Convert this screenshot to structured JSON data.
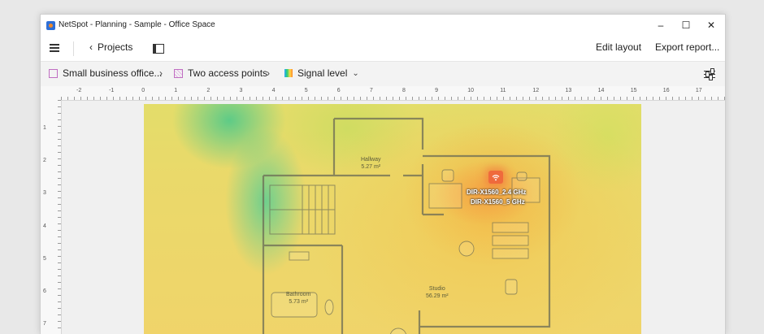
{
  "window": {
    "title": "NetSpot - Planning - Sample - Office Space",
    "controls": {
      "minimize": "–",
      "maximize": "☐",
      "close": "✕"
    }
  },
  "toolbar": {
    "back_label": "Projects",
    "edit_layout_label": "Edit layout",
    "export_label": "Export report..."
  },
  "breadcrumb": {
    "items": [
      {
        "label": "Small business office...",
        "icon": "floorplan-icon"
      },
      {
        "label": "Two access points",
        "icon": "zone-grid-icon"
      },
      {
        "label": "Signal level",
        "icon": "signal-gradient-icon"
      }
    ]
  },
  "rulers": {
    "horizontal": [
      "-2",
      "-1",
      "0",
      "1",
      "2",
      "3",
      "4",
      "5",
      "6",
      "7",
      "8",
      "9",
      "10",
      "11",
      "12",
      "13",
      "14",
      "15",
      "16",
      "17"
    ],
    "vertical": [
      "1",
      "2",
      "3",
      "4",
      "5",
      "6",
      "7"
    ]
  },
  "rooms": [
    {
      "name": "Hallway",
      "area": "5.27 m²"
    },
    {
      "name": "Bathroom",
      "area": "5.73 m²"
    },
    {
      "name": "Studio",
      "area": "56.29 m²"
    }
  ],
  "access_point": {
    "labels": [
      "DIR-X1560_2.4 GHz",
      "DIR-X1560_5 GHz"
    ]
  },
  "colors": {
    "accent": "#c06ec2",
    "ap": "#ef6a3c",
    "heat_low": "#3cc88c",
    "heat_mid": "#e8dc6a",
    "heat_high": "#f29a45"
  }
}
